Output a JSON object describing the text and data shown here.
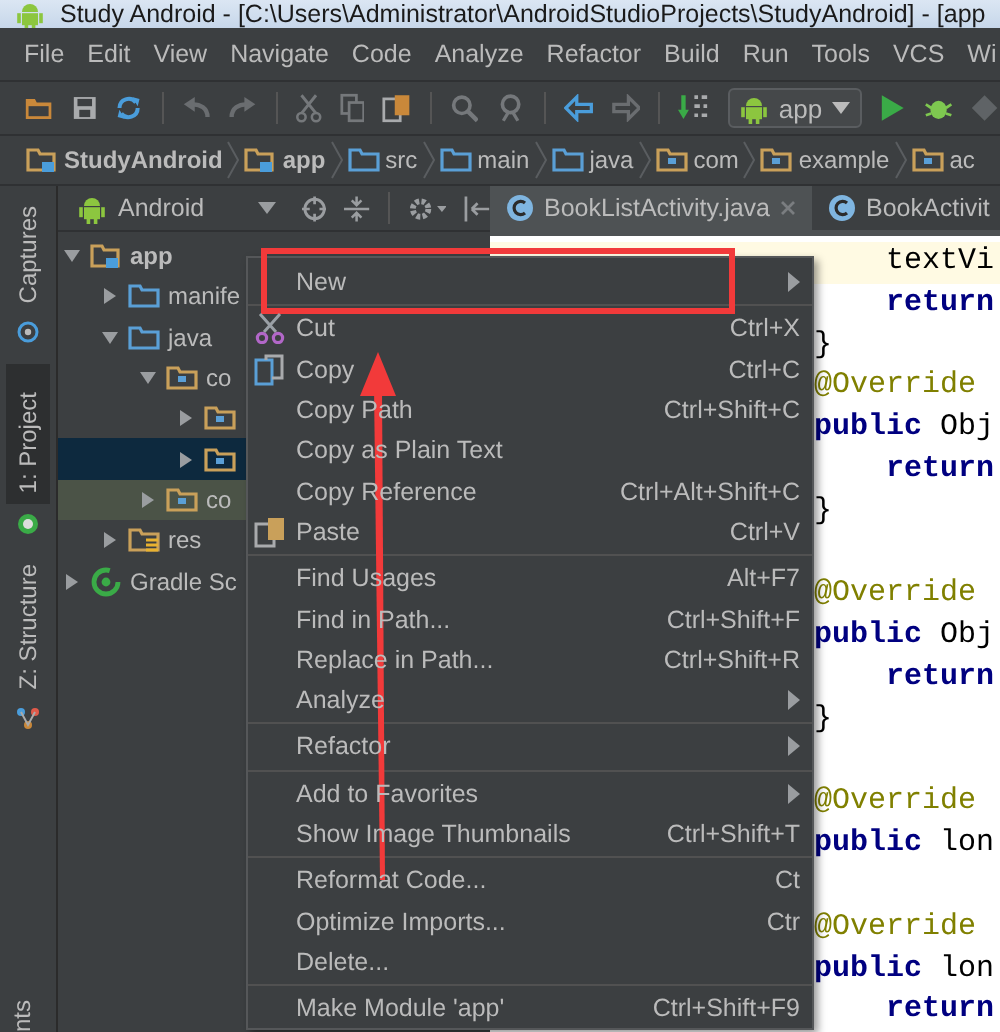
{
  "window": {
    "title": "Study Android - [C:\\Users\\Administrator\\AndroidStudioProjects\\StudyAndroid] - [app"
  },
  "menu_bar": [
    "File",
    "Edit",
    "View",
    "Navigate",
    "Code",
    "Analyze",
    "Refactor",
    "Build",
    "Run",
    "Tools",
    "VCS",
    "Wi"
  ],
  "toolbar": {
    "run_config": "app"
  },
  "breadcrumbs": [
    {
      "label": "StudyAndroid",
      "kind": "module"
    },
    {
      "label": "app",
      "kind": "module"
    },
    {
      "label": "src",
      "kind": "folder"
    },
    {
      "label": "main",
      "kind": "folder"
    },
    {
      "label": "java",
      "kind": "source"
    },
    {
      "label": "com",
      "kind": "package"
    },
    {
      "label": "example",
      "kind": "package"
    },
    {
      "label": "ac",
      "kind": "package"
    }
  ],
  "side_tabs": [
    {
      "label": "Captures",
      "selected": false
    },
    {
      "label": "1: Project",
      "selected": true
    },
    {
      "label": "Z: Structure",
      "selected": false
    }
  ],
  "side_tab_bottom": {
    "label": "nts"
  },
  "project_panel": {
    "view": "Android",
    "tree": [
      {
        "label": "app",
        "kind": "module",
        "expanded": true,
        "selected": false,
        "children": [
          {
            "label": "manife",
            "kind": "folder",
            "expanded": false,
            "selected": false
          },
          {
            "label": "java",
            "kind": "folder",
            "expanded": true,
            "selected": false,
            "children": [
              {
                "label": "co",
                "kind": "package",
                "expanded": true,
                "selected": false,
                "children": [
                  {
                    "kind": "package",
                    "expanded": false,
                    "selected": false
                  },
                  {
                    "kind": "package",
                    "expanded": false,
                    "selected": true
                  }
                ]
              },
              {
                "label": "co",
                "kind": "test_package",
                "expanded": false,
                "selected": false
              }
            ]
          },
          {
            "label": "res",
            "kind": "res",
            "expanded": false,
            "selected": false
          }
        ]
      },
      {
        "label": "Gradle Sc",
        "kind": "gradle",
        "expanded": false,
        "selected": false
      }
    ]
  },
  "editor": {
    "tabs": [
      {
        "label": "BookListActivity.java",
        "selected": true,
        "closable": true
      },
      {
        "label": "BookActivit",
        "selected": false,
        "closable": false
      }
    ],
    "lines": [
      {
        "parts": [
          {
            "text": "    textVi",
            "kind": "plain"
          }
        ],
        "current": true,
        "gap_before": false
      },
      {
        "parts": [
          {
            "text": "    return",
            "kind": "keyword"
          }
        ],
        "current": false,
        "gap_before": false
      },
      {
        "parts": [
          {
            "text": "}",
            "kind": "plain"
          }
        ],
        "current": false,
        "gap_before": false
      },
      {
        "parts": [
          {
            "text": "@Override",
            "kind": "annotation"
          }
        ],
        "current": false,
        "gap_before": false
      },
      {
        "parts": [
          {
            "text": "public",
            "kind": "keyword"
          },
          {
            "text": " Obj",
            "kind": "plain"
          }
        ],
        "current": false,
        "gap_before": false
      },
      {
        "parts": [
          {
            "text": "    return",
            "kind": "keyword"
          }
        ],
        "current": false,
        "gap_before": false
      },
      {
        "parts": [
          {
            "text": "}",
            "kind": "plain"
          }
        ],
        "current": false,
        "gap_before": false
      },
      {
        "parts": [
          {
            "text": "@Override",
            "kind": "annotation"
          }
        ],
        "current": false,
        "gap_before": true
      },
      {
        "parts": [
          {
            "text": "public",
            "kind": "keyword"
          },
          {
            "text": " Obj",
            "kind": "plain"
          }
        ],
        "current": false,
        "gap_before": false
      },
      {
        "parts": [
          {
            "text": "    return",
            "kind": "keyword"
          }
        ],
        "current": false,
        "gap_before": false
      },
      {
        "parts": [
          {
            "text": "}",
            "kind": "plain"
          }
        ],
        "current": false,
        "gap_before": false
      },
      {
        "parts": [
          {
            "text": "@Override",
            "kind": "annotation"
          }
        ],
        "current": false,
        "gap_before": true
      },
      {
        "parts": [
          {
            "text": "public",
            "kind": "keyword"
          },
          {
            "text": " lon",
            "kind": "plain"
          }
        ],
        "current": false,
        "gap_before": false
      },
      {
        "parts": [
          {
            "text": "@Override",
            "kind": "annotation"
          }
        ],
        "current": false,
        "gap_before": true
      },
      {
        "parts": [
          {
            "text": "public",
            "kind": "keyword"
          },
          {
            "text": " lon",
            "kind": "plain"
          }
        ],
        "current": false,
        "gap_before": false
      },
      {
        "parts": [
          {
            "text": "    return",
            "kind": "keyword"
          }
        ],
        "current": false,
        "gap_before": false
      }
    ]
  },
  "context_menu": [
    {
      "kind": "item",
      "label": "New",
      "submenu": true
    },
    {
      "kind": "separator"
    },
    {
      "kind": "item",
      "label": "Cut",
      "shortcut": "Ctrl+X",
      "submenu": false
    },
    {
      "kind": "item",
      "label": "Copy",
      "shortcut": "Ctrl+C",
      "submenu": false
    },
    {
      "kind": "item",
      "label": "Copy Path",
      "shortcut": "Ctrl+Shift+C",
      "submenu": false
    },
    {
      "kind": "item",
      "label": "Copy as Plain Text",
      "submenu": false
    },
    {
      "kind": "item",
      "label": "Copy Reference",
      "shortcut": "Ctrl+Alt+Shift+C",
      "submenu": false
    },
    {
      "kind": "item",
      "label": "Paste",
      "shortcut": "Ctrl+V",
      "submenu": false
    },
    {
      "kind": "separator"
    },
    {
      "kind": "item",
      "label": "Find Usages",
      "shortcut": "Alt+F7",
      "submenu": false
    },
    {
      "kind": "item",
      "label": "Find in Path...",
      "shortcut": "Ctrl+Shift+F",
      "submenu": false
    },
    {
      "kind": "item",
      "label": "Replace in Path...",
      "shortcut": "Ctrl+Shift+R",
      "submenu": false
    },
    {
      "kind": "item",
      "label": "Analyze",
      "submenu": true
    },
    {
      "kind": "separator"
    },
    {
      "kind": "item",
      "label": "Refactor",
      "submenu": true
    },
    {
      "kind": "separator"
    },
    {
      "kind": "item",
      "label": "Add to Favorites",
      "submenu": true
    },
    {
      "kind": "item",
      "label": "Show Image Thumbnails",
      "shortcut": "Ctrl+Shift+T",
      "submenu": false
    },
    {
      "kind": "separator"
    },
    {
      "kind": "item",
      "label": "Reformat Code...",
      "shortcut": "Ct",
      "submenu": false
    },
    {
      "kind": "item",
      "label": "Optimize Imports...",
      "shortcut": "Ctr",
      "submenu": false
    },
    {
      "kind": "item",
      "label": "Delete...",
      "submenu": false
    },
    {
      "kind": "separator"
    },
    {
      "kind": "item",
      "label": "Make Module 'app'",
      "shortcut": "Ctrl+Shift+F9",
      "submenu": false
    }
  ]
}
